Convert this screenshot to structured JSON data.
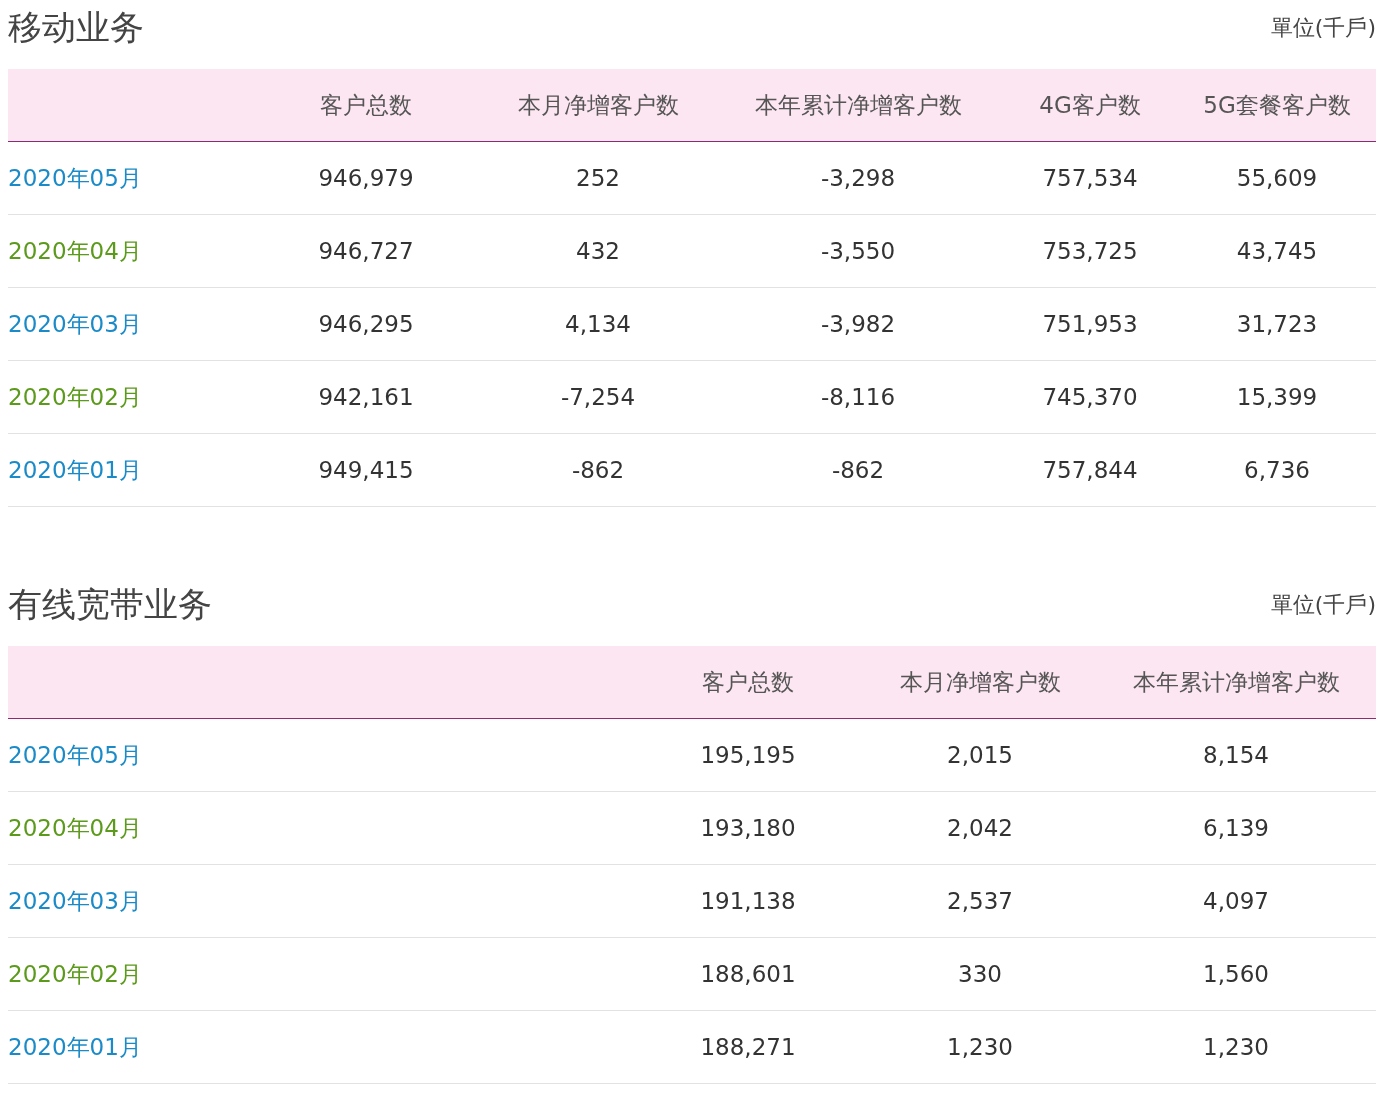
{
  "sections": [
    {
      "title": "移动业务",
      "unit": "單位(千戶)",
      "columns": [
        "客户总数",
        "本月净增客户数",
        "本年累计净增客户数",
        "4G客户数",
        "5G套餐客户数"
      ],
      "rows": [
        {
          "month": "2020年05月",
          "color": "#1a8bc8",
          "values": [
            "946,979",
            "252",
            "-3,298",
            "757,534",
            "55,609"
          ]
        },
        {
          "month": "2020年04月",
          "color": "#5c9a1b",
          "values": [
            "946,727",
            "432",
            "-3,550",
            "753,725",
            "43,745"
          ]
        },
        {
          "month": "2020年03月",
          "color": "#1a8bc8",
          "values": [
            "946,295",
            "4,134",
            "-3,982",
            "751,953",
            "31,723"
          ]
        },
        {
          "month": "2020年02月",
          "color": "#5c9a1b",
          "values": [
            "942,161",
            "-7,254",
            "-8,116",
            "745,370",
            "15,399"
          ]
        },
        {
          "month": "2020年01月",
          "color": "#1a8bc8",
          "values": [
            "949,415",
            "-862",
            "-862",
            "757,844",
            "6,736"
          ]
        }
      ]
    },
    {
      "title": "有线宽带业务",
      "unit": "單位(千戶)",
      "columns": [
        "客户总数",
        "本月净增客户数",
        "本年累计净增客户数"
      ],
      "rows": [
        {
          "month": "2020年05月",
          "color": "#1a8bc8",
          "values": [
            "195,195",
            "2,015",
            "8,154"
          ]
        },
        {
          "month": "2020年04月",
          "color": "#5c9a1b",
          "values": [
            "193,180",
            "2,042",
            "6,139"
          ]
        },
        {
          "month": "2020年03月",
          "color": "#1a8bc8",
          "values": [
            "191,138",
            "2,537",
            "4,097"
          ]
        },
        {
          "month": "2020年02月",
          "color": "#5c9a1b",
          "values": [
            "188,601",
            "330",
            "1,560"
          ]
        },
        {
          "month": "2020年01月",
          "color": "#1a8bc8",
          "values": [
            "188,271",
            "1,230",
            "1,230"
          ]
        }
      ]
    }
  ]
}
